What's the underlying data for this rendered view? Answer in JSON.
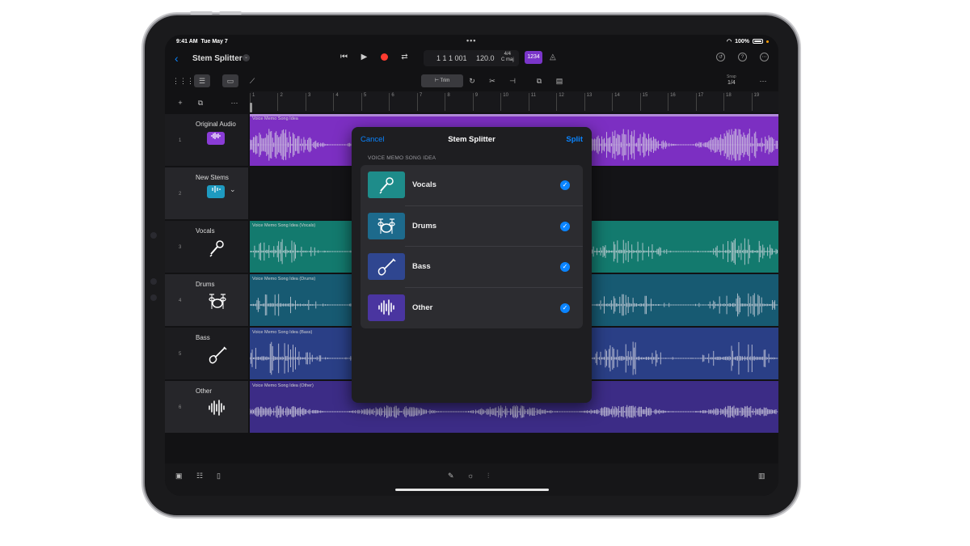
{
  "status": {
    "time": "9:41 AM",
    "date": "Tue May 7",
    "battery": "100%"
  },
  "header": {
    "title": "Stem Splitter",
    "position": "1 1 1 001",
    "tempo": "120.0",
    "time_signature": "4/4",
    "key": "C maj",
    "count_in": "1234"
  },
  "toolbar": {
    "trim_label": "Trim",
    "snap_label": "Snap",
    "snap_value": "1/4"
  },
  "ruler": [
    "1",
    "2",
    "3",
    "4",
    "5",
    "6",
    "7",
    "8",
    "9",
    "10",
    "11",
    "12",
    "13",
    "14",
    "15",
    "16",
    "17",
    "18",
    "19"
  ],
  "tracks": [
    {
      "number": "1",
      "name": "Original Audio",
      "region": "Voice Memo Song Idea",
      "color": "#7c2fc2",
      "icon": "waveform-icon"
    },
    {
      "number": "2",
      "name": "New Stems",
      "region": "",
      "color": "#1c8fb0",
      "icon": "stems-icon"
    },
    {
      "number": "3",
      "name": "Vocals",
      "region": "Voice Memo Song Idea (Vocals)",
      "color": "#137a6e",
      "icon": "microphone-icon"
    },
    {
      "number": "4",
      "name": "Drums",
      "region": "Voice Memo Song Idea (Drums)",
      "color": "#175a72",
      "icon": "drum-kit-icon"
    },
    {
      "number": "5",
      "name": "Bass",
      "region": "Voice Memo Song Idea (Bass)",
      "color": "#2a3f86",
      "icon": "bass-guitar-icon"
    },
    {
      "number": "6",
      "name": "Other",
      "region": "Voice Memo Song Idea (Other)",
      "color": "#3c2c86",
      "icon": "other-waveform-icon"
    }
  ],
  "dialog": {
    "cancel": "Cancel",
    "title": "Stem Splitter",
    "split": "Split",
    "section": "VOICE MEMO SONG IDEA",
    "items": [
      {
        "label": "Vocals",
        "color": "#1e8c8a",
        "icon": "microphone-icon"
      },
      {
        "label": "Drums",
        "color": "#1d6a8c",
        "icon": "drum-kit-icon"
      },
      {
        "label": "Bass",
        "color": "#2f4690",
        "icon": "bass-guitar-icon"
      },
      {
        "label": "Other",
        "color": "#4a35a0",
        "icon": "other-waveform-icon"
      }
    ]
  }
}
